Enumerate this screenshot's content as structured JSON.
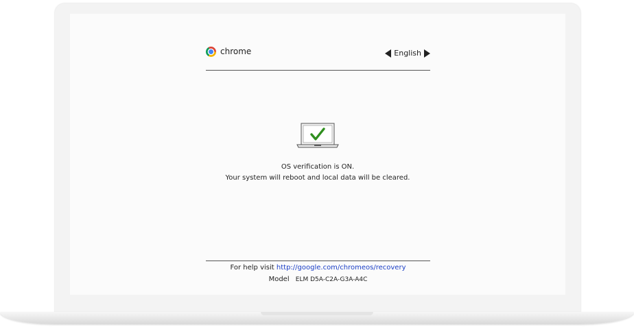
{
  "header": {
    "brand": "chrome",
    "language": "English"
  },
  "status": {
    "icon": "laptop-check-icon",
    "line1": "OS verification is ON.",
    "line2": "Your system will reboot and local data will be cleared."
  },
  "footer": {
    "help_prefix": "For help visit",
    "help_link": "http://google.com/chromeos/recovery",
    "model_label": "Model",
    "model_value": "ELM D5A-C2A-G3A-A4C"
  },
  "colors": {
    "link": "#1a3ec6",
    "check": "#2f8f1f"
  }
}
